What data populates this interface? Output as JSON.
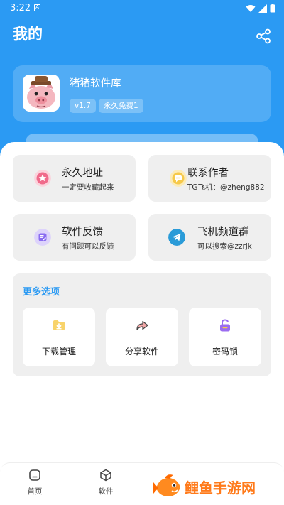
{
  "status_bar": {
    "time": "3:22",
    "notification_letter": "A"
  },
  "header": {
    "title": "我的",
    "share_icon": "share-icon"
  },
  "profile": {
    "app_name": "猪猪软件库",
    "version_badge": "v1.7",
    "free_badge": "永久免费1",
    "avatar_icon": "pig-avatar-icon"
  },
  "tiles": [
    {
      "title": "永久地址",
      "subtitle": "一定要收藏起来",
      "icon": "star-icon",
      "color": "#f06b8b"
    },
    {
      "title": "联系作者",
      "subtitle": "TG飞机：@zheng882",
      "icon": "chat-icon",
      "color": "#f6c94a"
    },
    {
      "title": "软件反馈",
      "subtitle": "有问题可以反馈",
      "icon": "feedback-icon",
      "color": "#8a6cf0"
    },
    {
      "title": "飞机频道群",
      "subtitle": "可以搜索@zzrjk",
      "icon": "telegram-icon",
      "color": "#2a9bd8"
    }
  ],
  "more": {
    "title": "更多选项",
    "options": [
      {
        "label": "下载管理",
        "icon": "download-folder-icon"
      },
      {
        "label": "分享软件",
        "icon": "share-arrow-icon"
      },
      {
        "label": "密码锁",
        "icon": "lock-icon"
      }
    ]
  },
  "bottom_nav": [
    {
      "label": "首页",
      "icon": "home-icon"
    },
    {
      "label": "软件",
      "icon": "box-icon"
    }
  ],
  "watermark": {
    "text": "鲤鱼手游网"
  },
  "colors": {
    "primary": "#2b9af3",
    "tile_bg": "#efefef",
    "watermark": "#ff7a1a"
  }
}
